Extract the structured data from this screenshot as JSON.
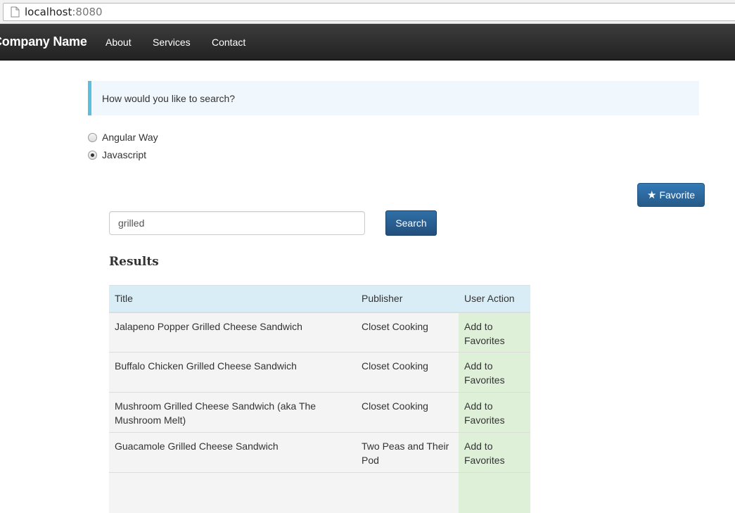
{
  "browser": {
    "url_host": "localhost",
    "url_port": ":8080"
  },
  "navbar": {
    "brand": "Company Name",
    "links": [
      "About",
      "Services",
      "Contact"
    ]
  },
  "alert": {
    "text": "How would you like to search?"
  },
  "search_mode": {
    "options": [
      {
        "label": "Angular Way",
        "checked": false
      },
      {
        "label": "Javascript",
        "checked": true
      }
    ]
  },
  "favorite_button": {
    "label": "Favorite",
    "icon": "star-icon"
  },
  "search": {
    "value": "grilled",
    "button_label": "Search"
  },
  "results": {
    "heading": "Results",
    "columns": [
      "Title",
      "Publisher",
      "User Action"
    ],
    "rows": [
      {
        "title": "Jalapeno Popper Grilled Cheese Sandwich",
        "publisher": "Closet Cooking",
        "action": "Add to Favorites"
      },
      {
        "title": "Buffalo Chicken Grilled Cheese Sandwich",
        "publisher": "Closet Cooking",
        "action": "Add to Favorites"
      },
      {
        "title": "Mushroom Grilled Cheese Sandwich (aka The Mushroom Melt)",
        "publisher": "Closet Cooking",
        "action": "Add to Favorites"
      },
      {
        "title": "Guacamole Grilled Cheese Sandwich",
        "publisher": "Two Peas and Their Pod",
        "action": "Add to Favorites"
      },
      {
        "title": "",
        "publisher": "",
        "action": ""
      }
    ]
  }
}
